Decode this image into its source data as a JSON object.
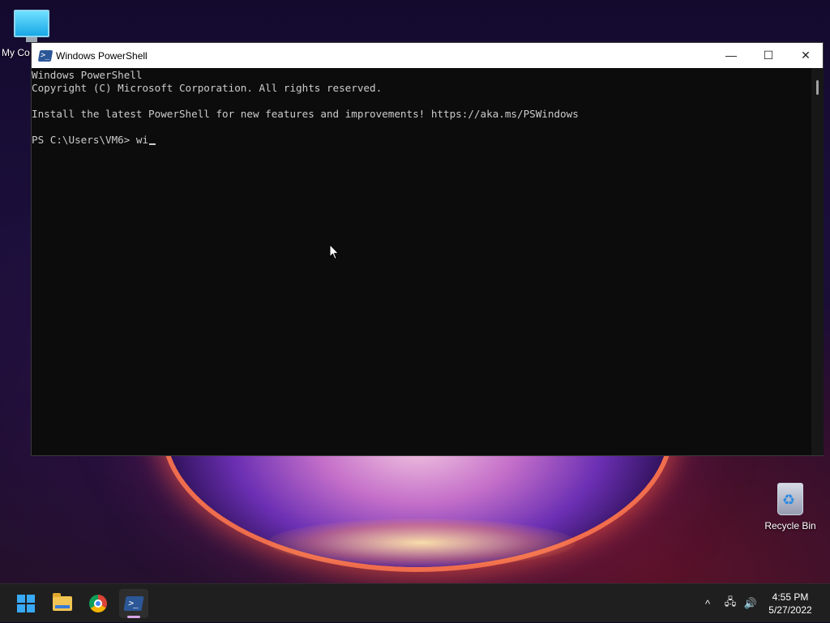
{
  "desktop": {
    "icons": [
      {
        "label": "My Co"
      },
      {
        "label": "Recycle Bin"
      }
    ]
  },
  "window": {
    "title": "Windows PowerShell",
    "controls": {
      "minimize": "—",
      "maximize": "☐",
      "close": "✕"
    },
    "console_lines": [
      "Windows PowerShell",
      "Copyright (C) Microsoft Corporation. All rights reserved.",
      "",
      "Install the latest PowerShell for new features and improvements! https://aka.ms/PSWindows",
      "",
      "PS C:\\Users\\VM6> wi"
    ]
  },
  "taskbar": {
    "apps": [
      {
        "name": "start",
        "icon": "windows-logo-icon"
      },
      {
        "name": "file-explorer",
        "icon": "folder-icon"
      },
      {
        "name": "chrome",
        "icon": "chrome-icon"
      },
      {
        "name": "powershell",
        "icon": "powershell-icon",
        "active": true
      }
    ],
    "tray": {
      "chevron": "^",
      "network": "🖧",
      "volume": "🔊"
    },
    "clock": {
      "time": "4:55 PM",
      "date": "5/27/2022"
    }
  },
  "colors": {
    "console_bg": "#0c0c0c",
    "console_text": "#cccccc",
    "taskbar_bg": "#1f1f1f",
    "powershell_blue": "#2b5797"
  }
}
